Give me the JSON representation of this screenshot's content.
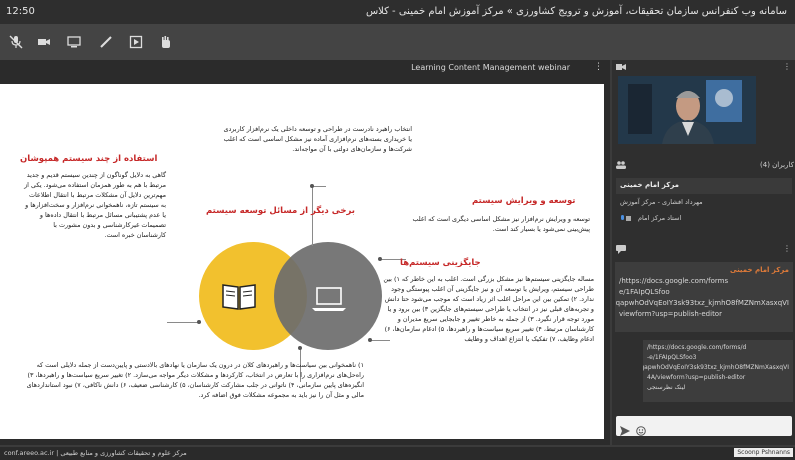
{
  "titlebar": {
    "time": "12:50",
    "title": "سامانه وب کنفرانس سازمان تحقیقات، آموزش و ترویج کشاورزی » مرکز آموزش امام خمینی - کلاس"
  },
  "presentation": {
    "doc_title": "Learning Content Management webinar",
    "slide": {
      "center_label": "برخی دیگر از مسائل توسعه سیستم",
      "top_block": "انتخاب راهبرد نادرست در طراحی و توسعه داخلی یک نرم‌افزار کاربردی یا خریداری بسته‌های نرم‌افزاری آماده نیز مشکل اساسی است که اغلب شرکت‌ها و سازمان‌های دولتی با آن مواجه‌اند.",
      "left_heading": "استفاده از چند سیستم همپوشان",
      "left_body": "گاهی به دلایل گوناگون از چندین سیستم قدیم و جدید مرتبط با هم به طور همزمان استفاده می‌شود. یکی از مهم‌ترین دلایل آن مشکلات مرتبط با انتقال اطلاعات به سیستم تازه، ناهمخوانی نرم‌افزار و سخت‌افزارها و یا عدم پشتیبانی مسائل مرتبط با انتقال داده‌ها و تصمیمات غیرکارشناسی و بدون مشورت با کارشناسان خبره است.",
      "right_heading1": "توسعه و ویرایش سیستم",
      "right_body1": "توسعه و ویرایش نرم‌افزار نیز مشکل اساسی دیگری است که اغلب پیش‌بینی نمی‌شود یا بسیار کند است.",
      "right_heading2": "جایگزینی سیستم‌ها",
      "right_body2": "مساله جایگزینی سیستم‌ها نیز مشکل بزرگی است. اغلب به این خاطر که ۱) بین طراحی سیستم، ویرایش یا توسعه آن و نیز جایگزینی آن اغلب پیوستگی وجود ندارد. ۲) تمکین بین این مراحل اغلب اثر زیاد است که موجب می‌شود حتا دانش و تجربه‌های قبلی نیز در انتخاب یا طراحی سیستم‌های جایگزین ۳) بین برود و یا مورد توجه قرار نگیرد. ۳) از جمله به خاطر تغییر و جابجایی سریع مدیران و کارشناسان مرتبط، ۴) تغییر سریع سیاست‌ها و راهبردها، ۵) ادغام سازمان‌ها، ۶) ادغام وظایف، ۷) تفکیک یا انتزاع اهداف و وظایف",
      "bottom_block": "۱) ناهمخوانی بین سیاست‌ها و راهبردهای کلان در درون یک سازمان یا نهادهای بالادستی و پایین‌دست از جمله دلایلی است که راه‌حل‌های نرم‌افزاری را با تعارض در انتخاب، کارکردها و مشکلات دیگر مواجه می‌سازد. ۲) تغییر سریع سیاست‌ها و راهبردها، ۳) انگیزه‌های پایین سازمانی، ۴) ناتوانی در جلب مشارکت کارشناسان، ۵) کارشناسی ضعیف، ۶) دانش ناکافی، ۷) نبود استانداردهای مالی و مثل آن را نیز باید به مجموعه مشکلات فوق اضافه کرد."
    }
  },
  "right_panel": {
    "people_header": "کاربران (4)",
    "people": [
      {
        "name": "مرکز امام خمینی",
        "role": ""
      },
      {
        "name": "مهرداد افشاری - مرکز آموزش",
        "role": ""
      },
      {
        "name": "استاد مرکز امام",
        "role": ""
      }
    ],
    "chat_sender": "مرکز امام خمینی",
    "chat_lines": [
      "https://docs.google.com/forms/",
      "e/1FAIpQLSfoo",
      "qapwhOdVqEoIY3sk93txz_kjmhO8fMZNmXasxqVI",
      "viewform?usp=publish-editor"
    ],
    "chat_lines_2": [
      "https://docs.google.com/forms/d/",
      "e/1FAIpQLSfoo3-",
      "qapwhOdVqEoIY3sk93txz_kjmhO8fMZNmXasxqVI",
      "4A/viewform?usp=publish-editor",
      "لینک نظرسنجی"
    ]
  },
  "statusbar": {
    "url": "conf.areeo.ac.ir | مرکز علوم و تحقیقات کشاورزی و منابع طبیعی",
    "brand": "Scoonp Pshnanns"
  },
  "colors": {
    "accent_red": "#c62828",
    "circle_yellow": "#f2c12e",
    "circle_gray": "#6c6c6c"
  }
}
